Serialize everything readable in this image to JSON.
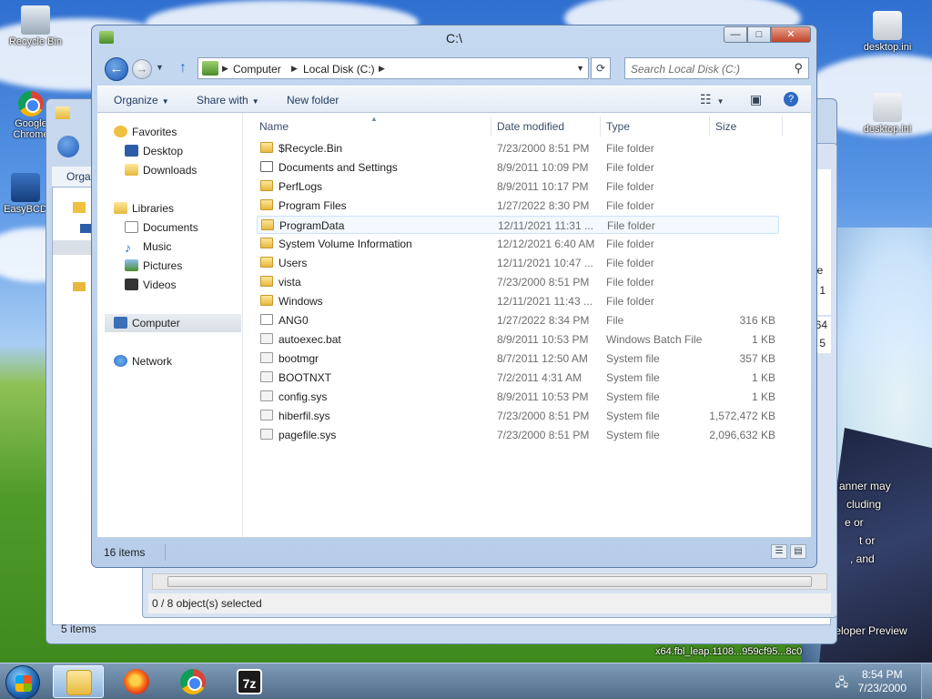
{
  "desktop": {
    "icons": [
      {
        "label": "Recycle Bin"
      },
      {
        "label": "Google Chrome"
      },
      {
        "label": "EasyBCD"
      },
      {
        "label": "desktop.ini"
      },
      {
        "label": "desktop.ini"
      }
    ],
    "watermark": {
      "line1": "Developer Preview",
      "line2": "x64.fbl_leap.1108...959cf95...8c0"
    },
    "fragments": [
      "anner may",
      "cluding",
      "e or",
      "t or",
      ", and"
    ]
  },
  "background_windows": {
    "win1": {
      "toolbar_fragment": "Orga",
      "status": "5 items"
    },
    "win2": {
      "status": "0 / 8 object(s) selected",
      "col_fragment": "File",
      "vals": [
        "1",
        "64",
        "5"
      ]
    }
  },
  "window": {
    "title": "C:\\",
    "controls": {
      "minimize": "—",
      "maximize": "□",
      "close": "✕"
    },
    "address": {
      "crumbs": [
        "Computer",
        "Local Disk (C:)"
      ]
    },
    "search": {
      "placeholder": "Search Local Disk (C:)"
    },
    "toolbar": {
      "organize": "Organize",
      "share_with": "Share with",
      "new_folder": "New folder"
    },
    "sidebar": {
      "favorites": "Favorites",
      "desktop": "Desktop",
      "downloads": "Downloads",
      "libraries": "Libraries",
      "documents": "Documents",
      "music": "Music",
      "pictures": "Pictures",
      "videos": "Videos",
      "computer": "Computer",
      "network": "Network"
    },
    "columns": {
      "name": "Name",
      "date": "Date modified",
      "type": "Type",
      "size": "Size"
    },
    "files": [
      {
        "name": "$Recycle.Bin",
        "date": "7/23/2000 8:51 PM",
        "type": "File folder",
        "size": "",
        "kind": "folder"
      },
      {
        "name": "Documents and Settings",
        "date": "8/9/2011 10:09 PM",
        "type": "File folder",
        "size": "",
        "kind": "link"
      },
      {
        "name": "PerfLogs",
        "date": "8/9/2011 10:17 PM",
        "type": "File folder",
        "size": "",
        "kind": "folder"
      },
      {
        "name": "Program Files",
        "date": "1/27/2022 8:30 PM",
        "type": "File folder",
        "size": "",
        "kind": "folder"
      },
      {
        "name": "ProgramData",
        "date": "12/11/2021 11:31 ...",
        "type": "File folder",
        "size": "",
        "kind": "folder"
      },
      {
        "name": "System Volume Information",
        "date": "12/12/2021 6:40 AM",
        "type": "File folder",
        "size": "",
        "kind": "folder"
      },
      {
        "name": "Users",
        "date": "12/11/2021 10:47 ...",
        "type": "File folder",
        "size": "",
        "kind": "folder"
      },
      {
        "name": "vista",
        "date": "7/23/2000 8:51 PM",
        "type": "File folder",
        "size": "",
        "kind": "folder"
      },
      {
        "name": "Windows",
        "date": "12/11/2021 11:43 ...",
        "type": "File folder",
        "size": "",
        "kind": "folder"
      },
      {
        "name": "ANG0",
        "date": "1/27/2022 8:34 PM",
        "type": "File",
        "size": "316 KB",
        "kind": "file"
      },
      {
        "name": "autoexec.bat",
        "date": "8/9/2011 10:53 PM",
        "type": "Windows Batch File",
        "size": "1 KB",
        "kind": "sys"
      },
      {
        "name": "bootmgr",
        "date": "8/7/2011 12:50 AM",
        "type": "System file",
        "size": "357 KB",
        "kind": "sys"
      },
      {
        "name": "BOOTNXT",
        "date": "7/2/2011 4:31 AM",
        "type": "System file",
        "size": "1 KB",
        "kind": "sys"
      },
      {
        "name": "config.sys",
        "date": "8/9/2011 10:53 PM",
        "type": "System file",
        "size": "1 KB",
        "kind": "sys"
      },
      {
        "name": "hiberfil.sys",
        "date": "7/23/2000 8:51 PM",
        "type": "System file",
        "size": "1,572,472 KB",
        "kind": "sys"
      },
      {
        "name": "pagefile.sys",
        "date": "7/23/2000 8:51 PM",
        "type": "System file",
        "size": "2,096,632 KB",
        "kind": "sys"
      }
    ],
    "status": {
      "count": "16 items"
    }
  },
  "taskbar": {
    "app_7z": "7z",
    "clock": {
      "time": "8:54 PM",
      "date": "7/23/2000"
    }
  }
}
